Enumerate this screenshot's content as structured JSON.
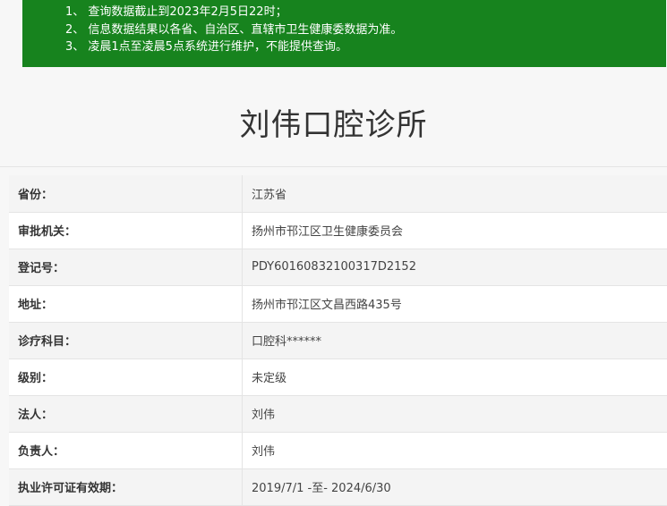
{
  "notice": {
    "items": [
      "1、 查询数据截止到2023年2月5日22时；",
      "2、 信息数据结果以各省、自治区、直辖市卫生健康委数据为准。",
      "3、 凌晨1点至凌晨5点系统进行维护，不能提供查询。"
    ]
  },
  "clinic": {
    "name": "刘伟口腔诊所"
  },
  "details": [
    {
      "label": "省份：",
      "value": "江苏省"
    },
    {
      "label": "审批机关：",
      "value": "扬州市邗江区卫生健康委员会"
    },
    {
      "label": "登记号：",
      "value": "PDY60160832100317D2152"
    },
    {
      "label": "地址：",
      "value": "扬州市邗江区文昌西路435号"
    },
    {
      "label": "诊疗科目：",
      "value": "口腔科******"
    },
    {
      "label": "级别：",
      "value": "未定级"
    },
    {
      "label": "法人：",
      "value": "刘伟"
    },
    {
      "label": "负责人：",
      "value": "刘伟"
    },
    {
      "label": "执业许可证有效期：",
      "value": "2019/7/1 -至- 2024/6/30"
    }
  ]
}
